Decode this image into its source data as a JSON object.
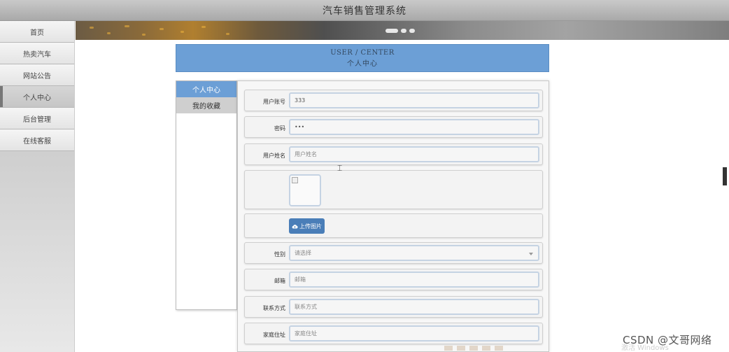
{
  "app": {
    "title": "汽车销售管理系统"
  },
  "sidebar": {
    "items": [
      {
        "label": "首页",
        "active": false
      },
      {
        "label": "热卖汽车",
        "active": false
      },
      {
        "label": "网站公告",
        "active": false
      },
      {
        "label": "个人中心",
        "active": true
      },
      {
        "label": "后台管理",
        "active": false
      },
      {
        "label": "在线客服",
        "active": false
      }
    ]
  },
  "header": {
    "en": "USER / CENTER",
    "cn": "个人中心"
  },
  "menu": {
    "items": [
      {
        "label": "个人中心",
        "active": true
      },
      {
        "label": "我的收藏",
        "active": false
      }
    ]
  },
  "form": {
    "account": {
      "label": "用户账号",
      "value": "333"
    },
    "password": {
      "label": "密码",
      "value": "•••"
    },
    "name": {
      "label": "用户姓名",
      "placeholder": "用户姓名"
    },
    "upload": {
      "label": "上传图片"
    },
    "gender": {
      "label": "性别",
      "placeholder": "请选择"
    },
    "email": {
      "label": "邮箱",
      "placeholder": "邮箱"
    },
    "phone": {
      "label": "联系方式",
      "placeholder": "联系方式"
    },
    "address": {
      "label": "家庭住址",
      "placeholder": "家庭住址"
    }
  },
  "watermark": {
    "text": "CSDN @文哥网络",
    "faint": "激活 Windows"
  },
  "colors": {
    "accent": "#6c9fd6",
    "button": "#4a7eb8"
  },
  "icons": {
    "upload": "cloud-upload-icon"
  }
}
